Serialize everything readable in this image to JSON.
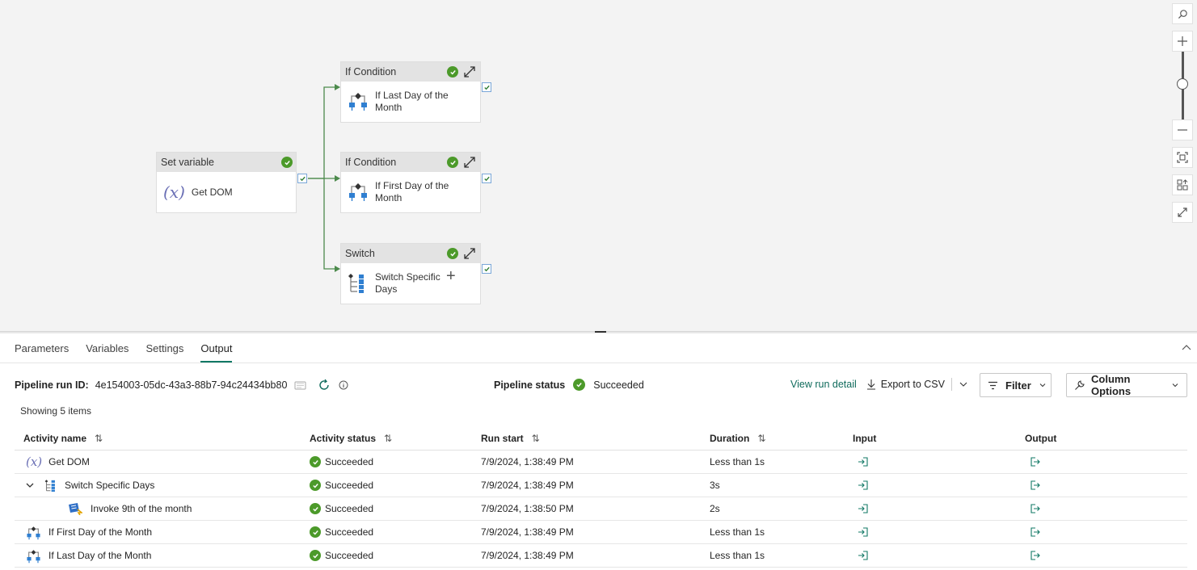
{
  "canvas": {
    "set_variable": {
      "type": "Set variable",
      "name": "Get DOM"
    },
    "if_last": {
      "type": "If Condition",
      "name": "If Last Day of the Month"
    },
    "if_first": {
      "type": "If Condition",
      "name": "If First Day of the Month"
    },
    "switch": {
      "type": "Switch",
      "name": "Switch Specific Days"
    }
  },
  "tabs": [
    "Parameters",
    "Variables",
    "Settings",
    "Output"
  ],
  "active_tab": "Output",
  "run": {
    "run_id_label": "Pipeline run ID:",
    "run_id": "4e154003-05dc-43a3-88b7-94c24434bb80",
    "status_label": "Pipeline status",
    "status": "Succeeded",
    "view_run_detail": "View run detail",
    "export_csv": "Export to CSV",
    "filter": "Filter",
    "column_options": "Column Options",
    "showing": "Showing 5 items"
  },
  "table": {
    "headers": [
      "Activity name",
      "Activity status",
      "Run start",
      "Duration",
      "Input",
      "Output"
    ],
    "rows": [
      {
        "name": "Get DOM",
        "icon": "variable-icon",
        "status": "Succeeded",
        "start": "7/9/2024, 1:38:49 PM",
        "duration": "Less than 1s"
      },
      {
        "name": "Switch Specific Days",
        "icon": "switch-icon",
        "status": "Succeeded",
        "start": "7/9/2024, 1:38:49 PM",
        "duration": "3s"
      },
      {
        "name": "Invoke 9th of the month",
        "icon": "invoke-pipeline-icon",
        "status": "Succeeded",
        "start": "7/9/2024, 1:38:50 PM",
        "duration": "2s"
      },
      {
        "name": "If First Day of the Month",
        "icon": "if-condition-icon",
        "status": "Succeeded",
        "start": "7/9/2024, 1:38:49 PM",
        "duration": "Less than 1s"
      },
      {
        "name": "If Last Day of the Month",
        "icon": "if-condition-icon",
        "status": "Succeeded",
        "start": "7/9/2024, 1:38:49 PM",
        "duration": "Less than 1s"
      }
    ]
  },
  "colors": {
    "success": "#4c9a2a",
    "link": "#0f6b5c",
    "connector": "#4c8a4c",
    "canvas_bg": "#f3f3f3"
  }
}
